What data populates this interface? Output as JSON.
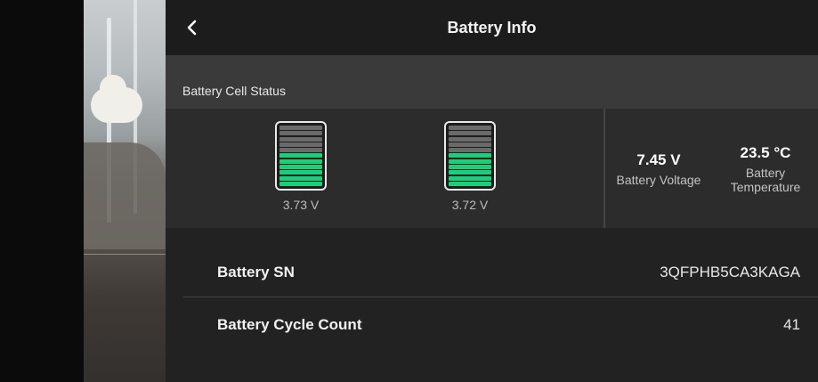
{
  "header": {
    "title": "Battery Info",
    "back_icon": "chevron-left-icon"
  },
  "cell_status": {
    "section_label": "Battery Cell Status",
    "cells": [
      {
        "voltage": "3.73 V",
        "level_bars_on": 6,
        "level_bars_total": 11
      },
      {
        "voltage": "3.72 V",
        "level_bars_on": 6,
        "level_bars_total": 11
      }
    ],
    "colors": {
      "cell_on": "#19d07a",
      "cell_off": "#6a6a6a"
    }
  },
  "metrics": {
    "voltage": {
      "value": "7.45 V",
      "label": "Battery Voltage"
    },
    "temperature": {
      "value": "23.5 °C",
      "label_line1": "Battery",
      "label_line2": "Temperature"
    }
  },
  "details": {
    "serial": {
      "label": "Battery SN",
      "value": "3QFPHB5CA3KAGA"
    },
    "cycles": {
      "label": "Battery Cycle Count",
      "value": "41"
    }
  }
}
